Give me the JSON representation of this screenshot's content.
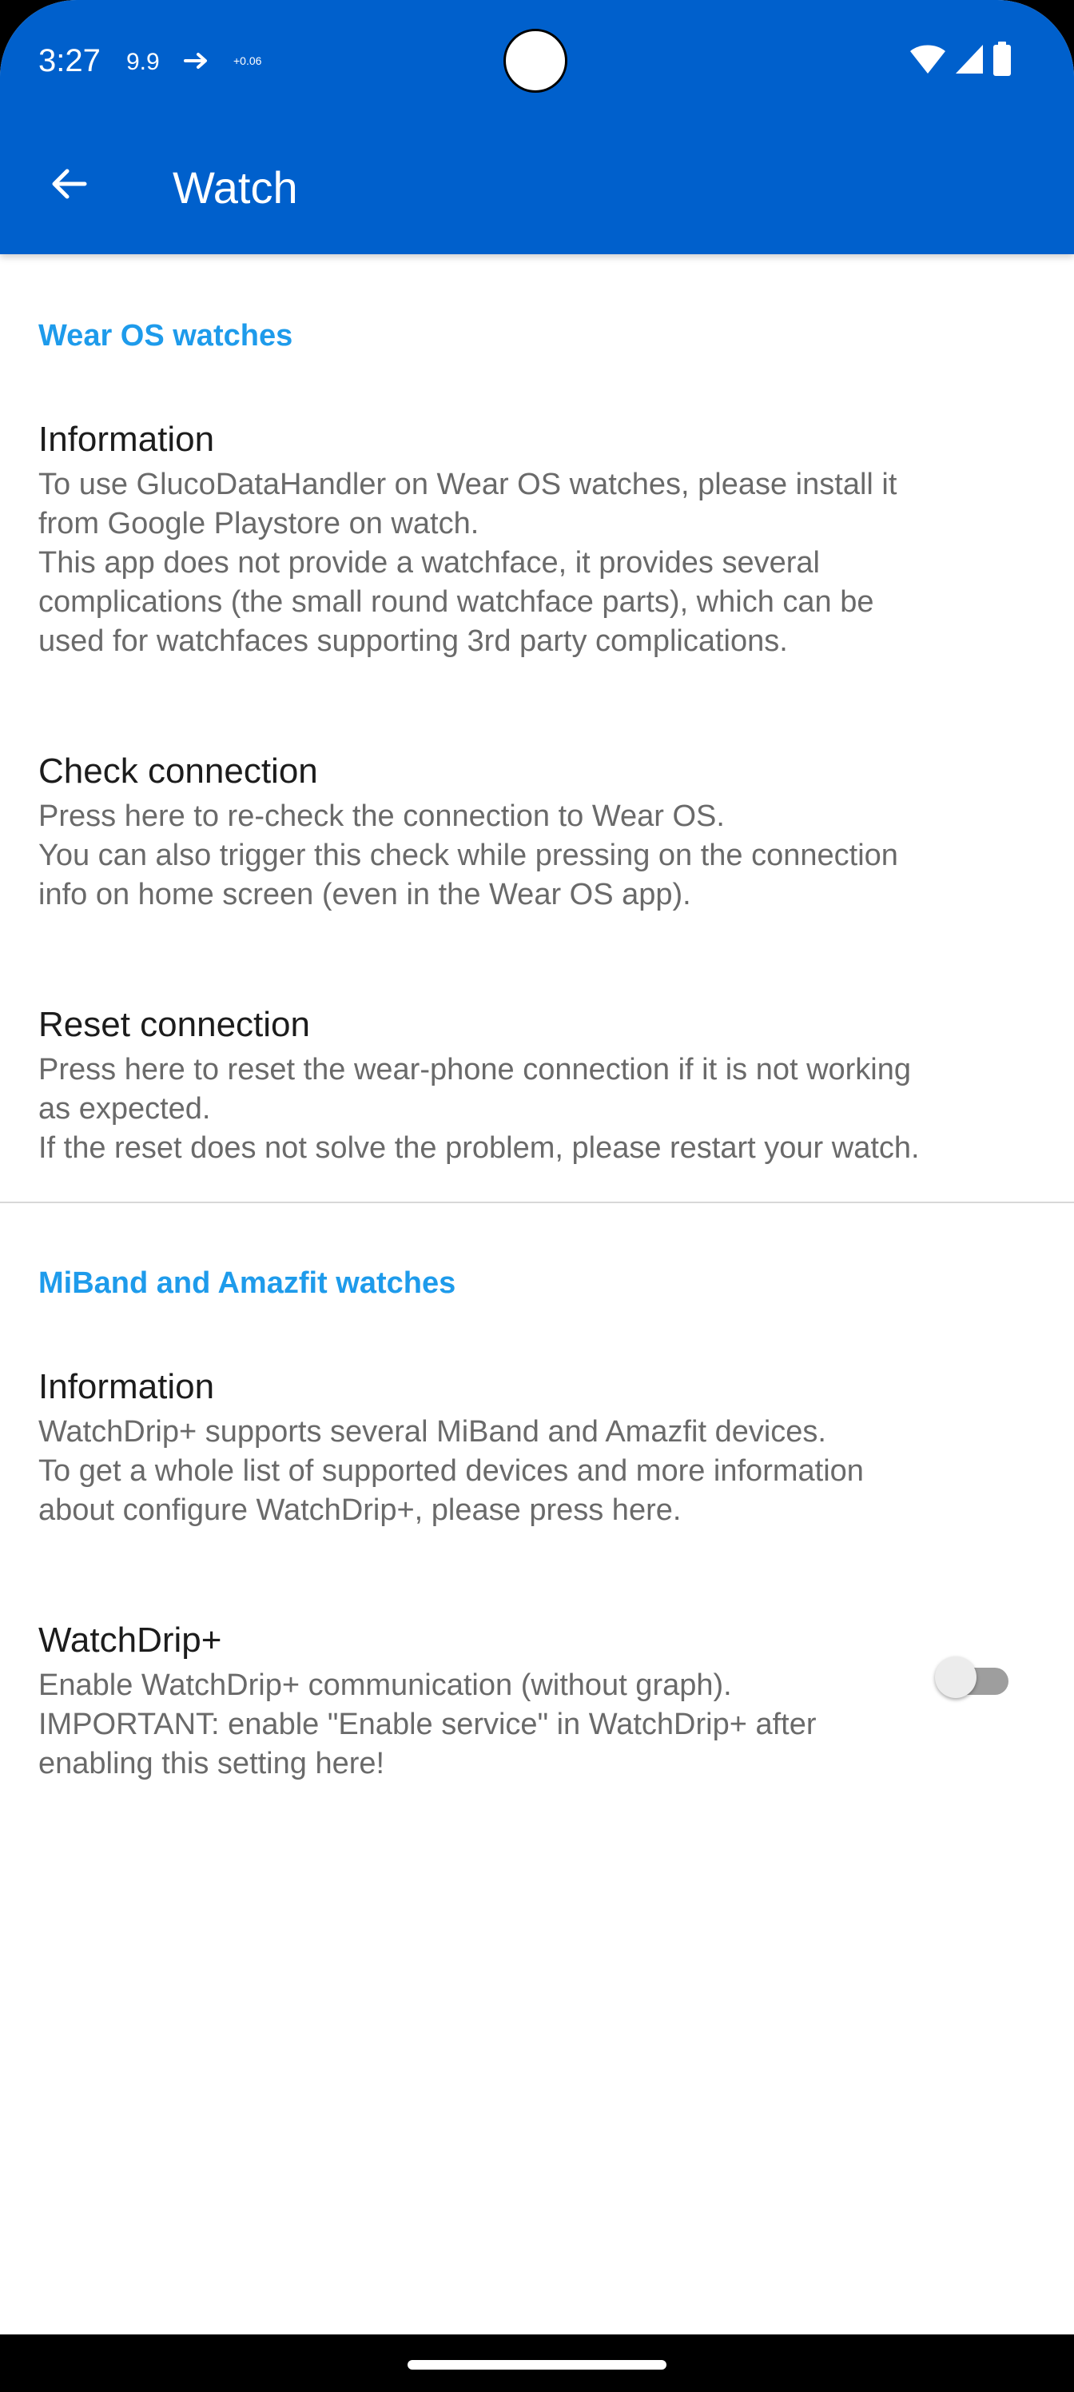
{
  "status_bar": {
    "time": "3:27",
    "glucose": "9.9",
    "delta": "+0.06",
    "icons": [
      "wifi-icon",
      "cellular-signal-icon",
      "battery-icon"
    ],
    "trend_icon": "arrow-right-icon"
  },
  "app_bar": {
    "title": "Watch",
    "back_icon": "arrow-back-icon",
    "color": "#0060CC"
  },
  "sections": [
    {
      "header": "Wear OS watches",
      "items": [
        {
          "title": "Information",
          "summary": [
            "To use GlucoDataHandler on Wear OS watches, please install it",
            "from Google Playstore on watch.",
            "This app does not provide a watchface, it provides several",
            "complications (the small round watchface parts), which can be",
            "used for watchfaces supporting 3rd party complications."
          ]
        },
        {
          "title": "Check connection",
          "summary": [
            "Press here to re-check the connection to Wear OS.",
            "You can also trigger this check while pressing on the connection",
            "info on home screen (even in the Wear OS app)."
          ]
        },
        {
          "title": "Reset connection",
          "summary": [
            "Press here to reset the wear-phone connection if it is not working",
            "as expected.",
            "If the reset does not solve the problem, please restart your watch."
          ]
        }
      ]
    },
    {
      "header": "MiBand and Amazfit watches",
      "items": [
        {
          "title": "Information",
          "summary": [
            "WatchDrip+ supports several MiBand and Amazfit devices.",
            "To get a whole list of supported devices and more information",
            "about configure WatchDrip+, please press here."
          ]
        },
        {
          "title": "WatchDrip+",
          "summary": [
            "Enable WatchDrip+ communication (without graph).",
            "IMPORTANT: enable \"Enable service\" in WatchDrip+ after",
            "enabling this setting here!"
          ],
          "switch_on": false
        }
      ]
    }
  ],
  "colors": {
    "accent": "#1E9BEB",
    "title_text": "#1c1c1c",
    "summary_text": "#6a6a6a"
  }
}
